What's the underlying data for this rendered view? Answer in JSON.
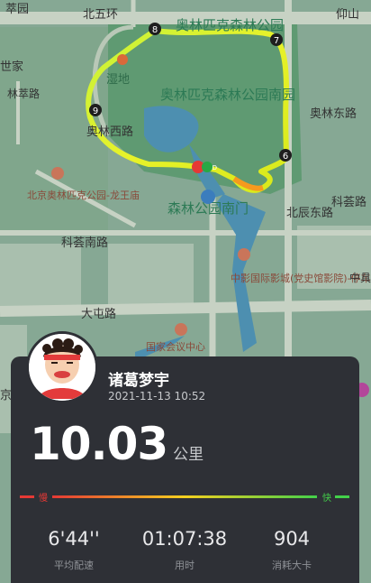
{
  "map": {
    "labels": {
      "north_fifth_ring": "北五环",
      "cuiyuan": "萃园",
      "yangshan": "仰山",
      "shijia": "世家",
      "linkao_road": "林萃路",
      "park_top": "奥林匹克森林公园",
      "wetland": "湿地",
      "park_south": "奥林匹克森林公园南园",
      "aolin_west_road": "奥林西路",
      "aolin_east_road": "奥林东路",
      "longwang_temple": "北京奥林匹克公园-龙王庙",
      "south_gate": "森林公园南门",
      "keyin_road": "科荟路",
      "keyin_south_road": "科荟南路",
      "beichen_east_road": "北辰东路",
      "cinema": "中影国际影城(党史馆影院)-停车场",
      "zhong": "中具罗",
      "datun_road": "大屯路",
      "convention_center": "国家会议中心",
      "jing": "京"
    },
    "km_markers": [
      "6",
      "7",
      "8",
      "9"
    ],
    "end_marker": "END"
  },
  "user": {
    "name": "诸葛梦宇",
    "date": "2021-11-13 10:52"
  },
  "distance": {
    "value": "10.03",
    "unit": "公里"
  },
  "pace_bar": {
    "slow_label": "慢",
    "fast_label": "快",
    "colors": [
      "#e53935",
      "#f5d020",
      "#43d04a"
    ]
  },
  "stats": [
    {
      "value": "6'44''",
      "label": "平均配速"
    },
    {
      "value": "01:07:38",
      "label": "用时"
    },
    {
      "value": "904",
      "label": "消耗大卡"
    }
  ]
}
